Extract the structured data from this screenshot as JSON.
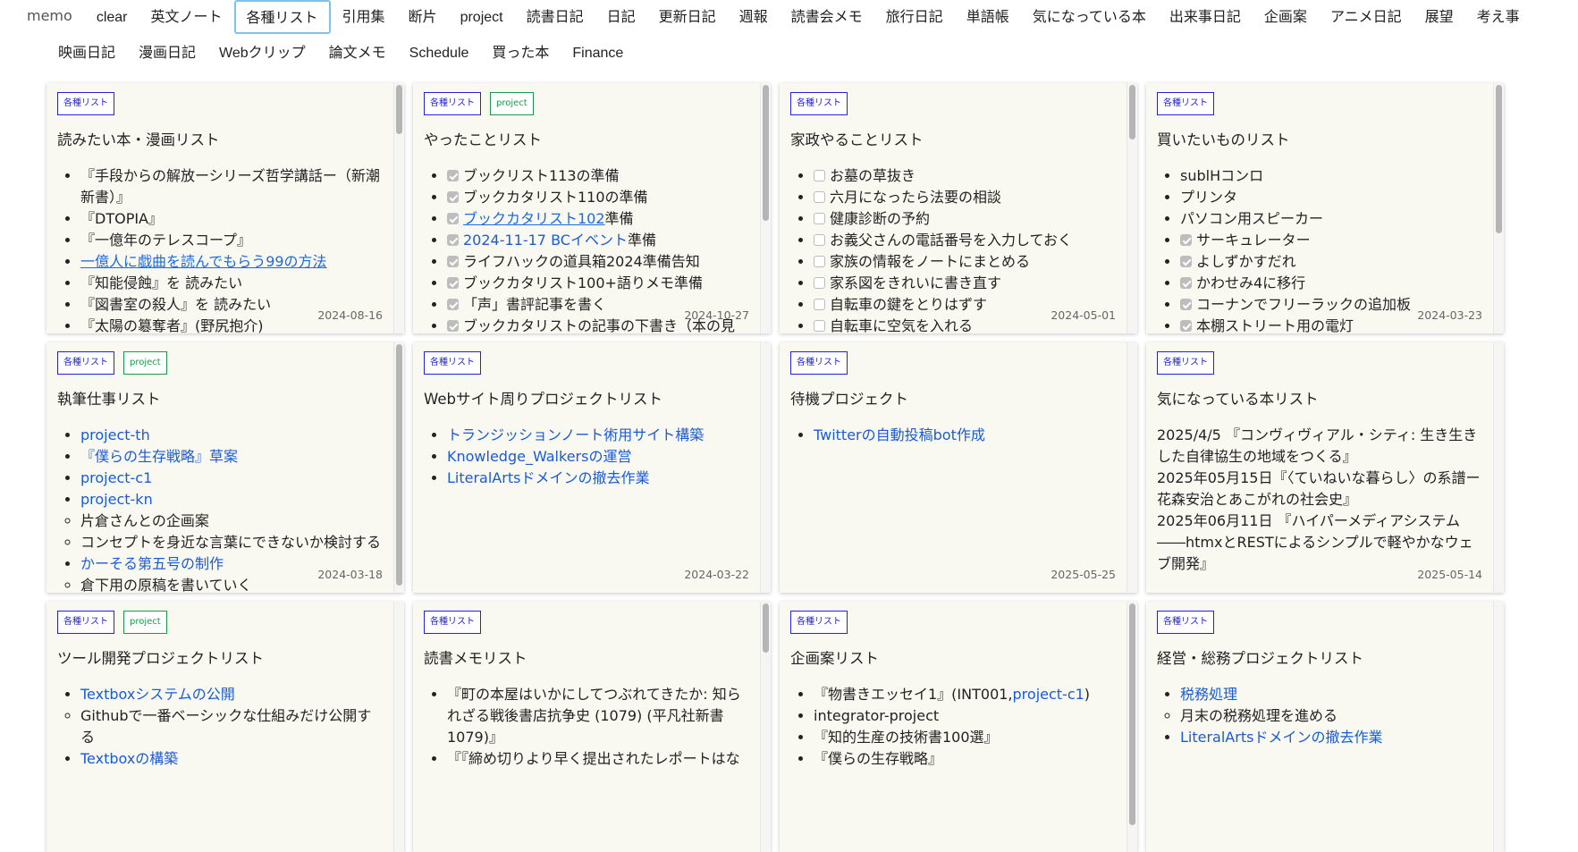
{
  "nav": {
    "brand": "memo",
    "active": "各種リスト",
    "row1": [
      "clear",
      "英文ノート",
      "各種リスト",
      "引用集",
      "断片",
      "project",
      "読書日記",
      "日記",
      "更新日記",
      "週報",
      "読書会メモ",
      "旅行日記",
      "単語帳",
      "気になっている本",
      "出来事日記",
      "企画案",
      "アニメ日記",
      "展望",
      "考え事"
    ],
    "row2": [
      "映画日記",
      "漫画日記",
      "Webクリップ",
      "論文メモ",
      "Schedule",
      "買った本",
      "Finance"
    ]
  },
  "cards": [
    {
      "tags": [
        "各種リスト"
      ],
      "title": "読みたい本・漫画リスト",
      "date": "2024-08-16",
      "scroll": 0.2,
      "items": [
        {
          "parts": [
            {
              "text": "『手段からの解放ーシリーズ哲学講話ー（新潮新書）』"
            }
          ]
        },
        {
          "parts": [
            {
              "text": "『DTOPIA』"
            }
          ]
        },
        {
          "parts": [
            {
              "text": "『一億年のテレスコープ』"
            }
          ]
        },
        {
          "parts": [
            {
              "text": "一億人に戯曲を読んでもらう99の方法",
              "link": "u"
            }
          ]
        },
        {
          "parts": [
            {
              "text": "『知能侵蝕』を 読みたい"
            }
          ]
        },
        {
          "parts": [
            {
              "text": "『図書室の殺人』を 読みたい"
            }
          ]
        },
        {
          "parts": [
            {
              "text": "『太陽の簒奪者』(野尻抱介)"
            }
          ]
        }
      ]
    },
    {
      "tags": [
        "各種リスト",
        "project"
      ],
      "title": "やったことリスト",
      "date": "2024-10-27",
      "scroll": 0.55,
      "items": [
        {
          "check": true,
          "parts": [
            {
              "text": "ブックリスト113の準備"
            }
          ]
        },
        {
          "check": true,
          "parts": [
            {
              "text": "ブックカタリスト110の準備"
            }
          ]
        },
        {
          "check": true,
          "parts": [
            {
              "text": "ブックカタリスト102",
              "link": "u"
            },
            {
              "text": "準備"
            }
          ]
        },
        {
          "check": true,
          "parts": [
            {
              "text": "2024-11-17 BCイベント",
              "link": "y"
            },
            {
              "text": "準備"
            }
          ]
        },
        {
          "check": true,
          "parts": [
            {
              "text": "ライフハックの道具箱2024準備告知"
            }
          ]
        },
        {
          "check": true,
          "parts": [
            {
              "text": "ブックカタリスト100+語りメモ準備"
            }
          ]
        },
        {
          "check": true,
          "parts": [
            {
              "text": "「声」書評記事を書く"
            }
          ]
        },
        {
          "check": true,
          "parts": [
            {
              "text": "ブックカタリストの記事の下書き（本の見"
            }
          ]
        }
      ]
    },
    {
      "tags": [
        "各種リスト"
      ],
      "title": "家政やることリスト",
      "date": "2024-05-01",
      "scroll": 0.22,
      "items": [
        {
          "check": false,
          "parts": [
            {
              "text": "お墓の草抜き"
            }
          ]
        },
        {
          "check": false,
          "parts": [
            {
              "text": "六月になったら法要の相談"
            }
          ]
        },
        {
          "check": false,
          "parts": [
            {
              "text": "健康診断の予約"
            }
          ]
        },
        {
          "check": false,
          "parts": [
            {
              "text": "お義父さんの電話番号を入力しておく"
            }
          ]
        },
        {
          "check": false,
          "parts": [
            {
              "text": "家族の情報をノートにまとめる"
            }
          ]
        },
        {
          "check": false,
          "parts": [
            {
              "text": "家系図をきれいに書き直す"
            }
          ]
        },
        {
          "check": false,
          "parts": [
            {
              "text": "自転車の鍵をとりはずす"
            }
          ]
        },
        {
          "check": false,
          "parts": [
            {
              "text": "自転車に空気を入れる"
            }
          ]
        }
      ]
    },
    {
      "tags": [
        "各種リスト"
      ],
      "title": "買いたいものリスト",
      "date": "2024-03-23",
      "scroll": 0.6,
      "items": [
        {
          "parts": [
            {
              "text": "sublHコンロ"
            }
          ]
        },
        {
          "parts": [
            {
              "text": "プリンタ"
            }
          ]
        },
        {
          "parts": [
            {
              "text": "パソコン用スピーカー"
            }
          ]
        },
        {
          "check": true,
          "parts": [
            {
              "text": "サーキュレーター"
            }
          ]
        },
        {
          "check": true,
          "parts": [
            {
              "text": "よしずかすだれ"
            }
          ]
        },
        {
          "check": true,
          "parts": [
            {
              "text": "かわせみ4に移行"
            }
          ]
        },
        {
          "check": true,
          "parts": [
            {
              "text": "コーナンでフリーラックの追加板"
            }
          ]
        },
        {
          "check": true,
          "parts": [
            {
              "text": "本棚ストリート用の電灯"
            }
          ]
        }
      ]
    },
    {
      "tags": [
        "各種リスト",
        "project"
      ],
      "title": "執筆仕事リスト",
      "date": "2024-03-18",
      "scroll": 0.98,
      "items": [
        {
          "parts": [
            {
              "text": "project-th",
              "link": "y"
            }
          ]
        },
        {
          "parts": [
            {
              "text": "『僕らの生存戦略』草案",
              "link": "y"
            }
          ]
        },
        {
          "parts": [
            {
              "text": "project-c1",
              "link": "y"
            }
          ]
        },
        {
          "parts": [
            {
              "text": "project-kn",
              "link": "y"
            }
          ]
        },
        {
          "sub": true,
          "parts": [
            {
              "text": "片倉さんとの企画案"
            }
          ]
        },
        {
          "sub": true,
          "parts": [
            {
              "text": "コンセプトを身近な言葉にできないか検討する"
            }
          ]
        },
        {
          "parts": [
            {
              "text": "かーそる第五号の制作",
              "link": "y"
            }
          ]
        },
        {
          "sub": true,
          "parts": [
            {
              "text": "倉下用の原稿を書いていく"
            }
          ]
        }
      ]
    },
    {
      "tags": [
        "各種リスト"
      ],
      "title": "Webサイト周りプロジェクトリスト",
      "date": "2024-03-22",
      "items": [
        {
          "parts": [
            {
              "text": "トランジッションノート術用サイト構築",
              "link": "y"
            }
          ]
        },
        {
          "parts": [
            {
              "text": "Knowledge_Walkersの運営",
              "link": "y"
            }
          ]
        },
        {
          "parts": [
            {
              "text": "LiteralArtsドメインの撤去作業",
              "link": "y"
            }
          ]
        }
      ]
    },
    {
      "tags": [
        "各種リスト"
      ],
      "title": "待機プロジェクト",
      "date": "2025-05-25",
      "items": [
        {
          "parts": [
            {
              "text": "Twitterの自動投稿bot作成",
              "link": "y"
            }
          ]
        }
      ]
    },
    {
      "tags": [
        "各種リスト"
      ],
      "title": "気になっている本リスト",
      "date": "2025-05-14",
      "paragraphs": [
        "2025/4/5 『コンヴィヴィアル・シティ: 生き生きした自律協生の地域をつくる』",
        "2025年05月15日『〈ていねいな暮らし〉の系譜ー花森安治とあこがれの社会史』",
        "2025年06月11日 『ハイパーメディアシステム――htmxとRESTによるシンプルで軽やかなウェブ開発』"
      ]
    },
    {
      "tags": [
        "各種リスト",
        "project"
      ],
      "title": "ツール開発プロジェクトリスト",
      "items": [
        {
          "parts": [
            {
              "text": "Textboxシステムの公開",
              "link": "y"
            }
          ]
        },
        {
          "sub": true,
          "parts": [
            {
              "text": "Githubで一番ベーシックな仕組みだけ公開する"
            }
          ]
        },
        {
          "parts": [
            {
              "text": "Textboxの構築",
              "link": "y"
            }
          ]
        }
      ]
    },
    {
      "tags": [
        "各種リスト"
      ],
      "title": "読書メモリスト",
      "scroll": 0.2,
      "items": [
        {
          "parts": [
            {
              "text": "『町の本屋はいかにしてつぶれてきたか: 知られざる戦後書店抗争史 (1079) (平凡社新書 1079)』"
            }
          ]
        },
        {
          "parts": [
            {
              "text": "『『締め切りより早く提出されたレポートはな"
            }
          ]
        }
      ]
    },
    {
      "tags": [
        "各種リスト"
      ],
      "title": "企画案リスト",
      "scroll": 0.9,
      "items": [
        {
          "parts": [
            {
              "text": "『物書きエッセイ1』(INT001,"
            },
            {
              "text": "project-c1",
              "link": "y"
            },
            {
              "text": ")"
            }
          ]
        },
        {
          "parts": [
            {
              "text": "integrator-project"
            }
          ]
        },
        {
          "parts": [
            {
              "text": "『知的生産の技術書100選』"
            }
          ]
        },
        {
          "parts": [
            {
              "text": "『僕らの生存戦略』"
            }
          ]
        }
      ]
    },
    {
      "tags": [
        "各種リスト"
      ],
      "title": "経営・総務プロジェクトリスト",
      "items": [
        {
          "parts": [
            {
              "text": "税務処理",
              "link": "y"
            }
          ]
        },
        {
          "sub": true,
          "parts": [
            {
              "text": "月末の税務処理を進める"
            }
          ]
        },
        {
          "parts": [
            {
              "text": "LiteralArtsドメインの撤去作業",
              "link": "y"
            }
          ]
        }
      ]
    }
  ]
}
